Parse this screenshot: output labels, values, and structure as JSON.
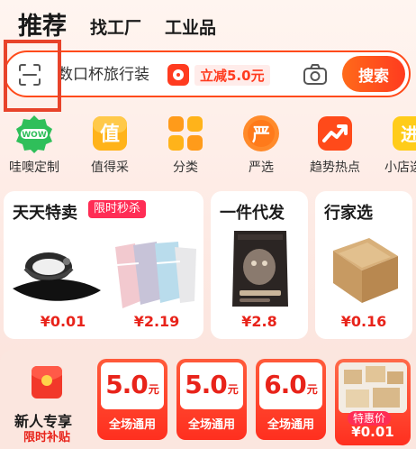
{
  "tabs": [
    {
      "label": "推荐",
      "active": true
    },
    {
      "label": "找工厂",
      "active": false
    },
    {
      "label": "工业品",
      "active": false
    }
  ],
  "search": {
    "query": "数口杯旅行装",
    "promo_text": "立减5.0元",
    "button_label": "搜索",
    "icons": {
      "scan": "scan-icon",
      "camera": "camera-icon",
      "promo": "red-packet-icon"
    }
  },
  "categories": [
    {
      "label": "哇噢定制",
      "icon": "wow-badge-icon",
      "color": "#2fbf5a"
    },
    {
      "label": "值得采",
      "icon": "zhi-badge-icon",
      "color": "#ffb31a"
    },
    {
      "label": "分类",
      "icon": "grid-icon",
      "color": "#ff9b1a"
    },
    {
      "label": "严选",
      "icon": "yan-badge-icon",
      "color": "#ff7a1a"
    },
    {
      "label": "趋势热点",
      "icon": "trend-arrow-icon",
      "color": "#ff4a1a"
    },
    {
      "label": "小店选",
      "icon": "jin-badge-icon",
      "color": "#ffcc1a"
    }
  ],
  "features": {
    "daily": {
      "title": "天天特卖",
      "badge": "限时秒杀",
      "items": [
        {
          "price": "¥0.01",
          "image": "black-sun-visor-image"
        },
        {
          "price": "¥2.19",
          "image": "hair-towel-image"
        }
      ]
    },
    "dropship": {
      "title": "一件代发",
      "item": {
        "price": "¥2.8",
        "image": "pet-food-bag-image"
      }
    },
    "expert": {
      "title": "行家选",
      "item": {
        "price": "¥0.16",
        "image": "cardboard-box-image"
      }
    }
  },
  "newbie": {
    "title": "新人专享",
    "subtitle": "限时补贴",
    "icon": "red-envelope-icon"
  },
  "coupons": [
    {
      "amount": "5.0",
      "unit": "元",
      "label": "全场通用"
    },
    {
      "amount": "5.0",
      "unit": "元",
      "label": "全场通用"
    },
    {
      "amount": "6.0",
      "unit": "元",
      "label": "全场通用"
    }
  ],
  "deal": {
    "tag": "特惠价",
    "price": "¥0.01",
    "image": "packaging-boxes-image"
  },
  "colors": {
    "accent": "#ff4a1a",
    "price": "#e8231a",
    "highlight_box": "#e8432a"
  }
}
